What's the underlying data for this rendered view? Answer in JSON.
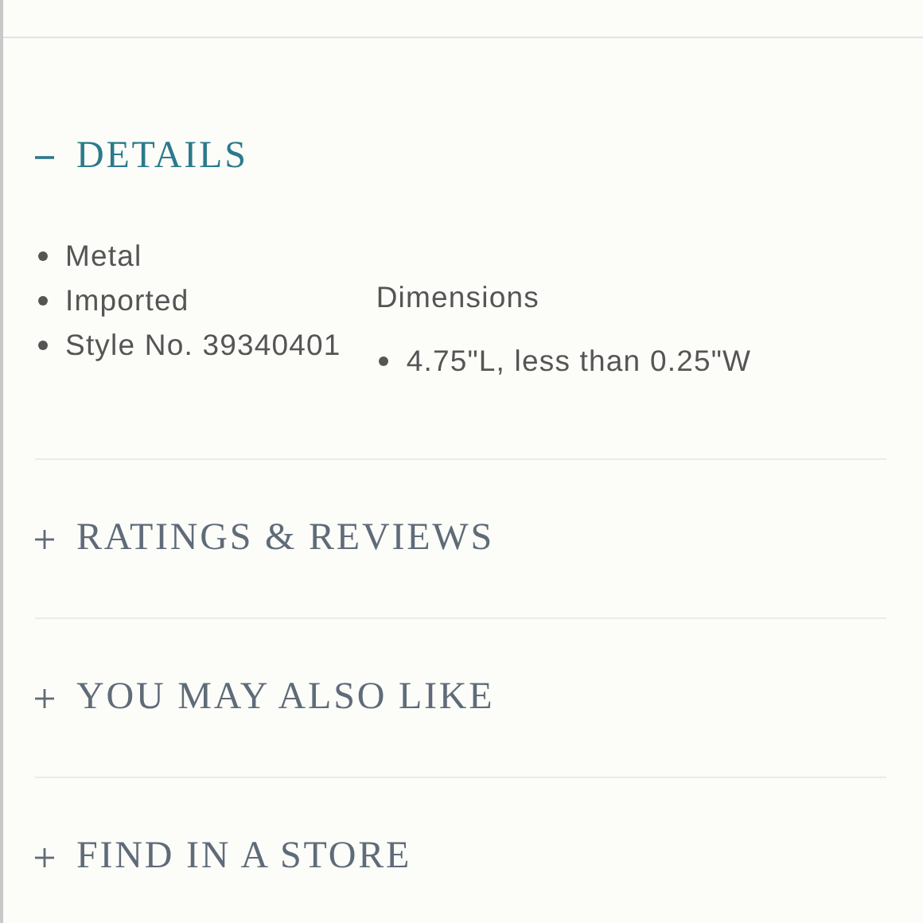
{
  "sections": [
    {
      "title": "DETAILS",
      "expanded": true,
      "features": [
        "Metal",
        "Imported",
        "Style No. 39340401"
      ],
      "dimensions": {
        "label": "Dimensions",
        "items": [
          "4.75\"L, less than 0.25\"W"
        ]
      }
    },
    {
      "title": "RATINGS & REVIEWS",
      "expanded": false
    },
    {
      "title": "YOU MAY ALSO LIKE",
      "expanded": false
    },
    {
      "title": "FIND IN A STORE",
      "expanded": false
    }
  ]
}
